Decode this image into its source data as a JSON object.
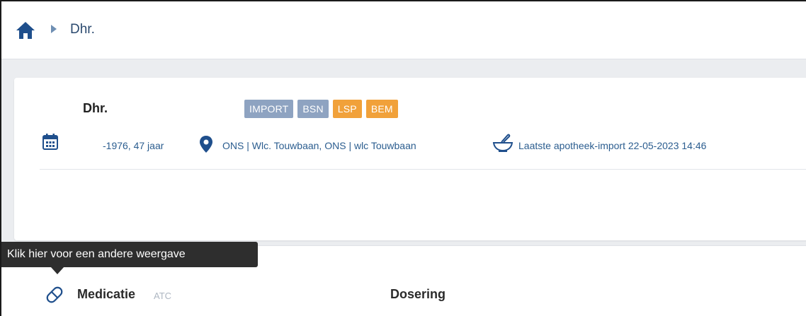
{
  "breadcrumb": {
    "home_icon": "home-icon",
    "separator_icon": "caret-right-icon",
    "current": "Dhr."
  },
  "patient": {
    "name": "Dhr.",
    "badges": [
      {
        "label": "IMPORT",
        "color": "#8ea3c1"
      },
      {
        "label": "BSN",
        "color": "#8ea3c1"
      },
      {
        "label": "LSP",
        "color": "#f1a13a"
      },
      {
        "label": "BEM",
        "color": "#f1a13a"
      }
    ],
    "dob_age": "-1976, 47 jaar",
    "location": "ONS | Wlc. Touwbaan, ONS | wlc Touwbaan",
    "last_import": "Laatste apotheek-import 22-05-2023 14:46"
  },
  "tooltip": {
    "text": "Klik hier voor een andere weergave"
  },
  "medication_table": {
    "header_medicatie": "Medicatie",
    "header_atc": "ATC",
    "header_dosering": "Dosering"
  },
  "colors": {
    "accent_blue": "#1f4f8c",
    "text_blue": "#2b5d8f",
    "badge_grey": "#8ea3c1",
    "badge_orange": "#f1a13a",
    "tooltip_bg": "#2e2e2e"
  }
}
